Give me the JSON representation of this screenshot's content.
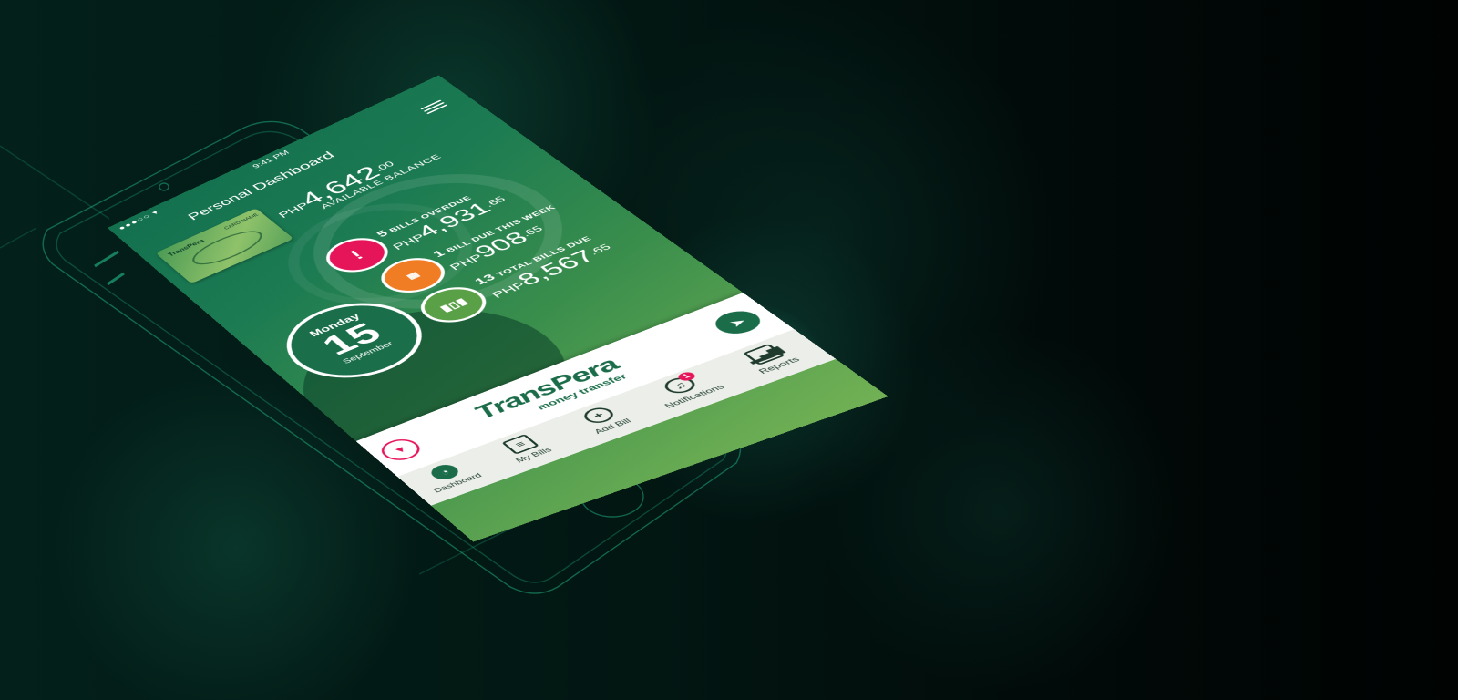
{
  "status_bar": {
    "signal": "●●●○○ ▾",
    "time": "9:41 PM"
  },
  "header": {
    "title": "Personal Dashboard"
  },
  "card": {
    "brand": "TransPera",
    "label": "CARD NAME"
  },
  "balance": {
    "currency": "PHP",
    "whole": "4,642",
    "cents": ".00",
    "label": "AVAILABLE BALANCE"
  },
  "date": {
    "day": "Monday",
    "number": "15",
    "month": "September"
  },
  "stats": [
    {
      "count": "5",
      "label": "BILLS OVERDUE",
      "currency": "PHP",
      "whole": "4,931",
      "cents": ".65",
      "icon": "exclamation-icon",
      "color": "#e6155a"
    },
    {
      "count": "1",
      "label": "BILL DUE THIS WEEK",
      "currency": "PHP",
      "whole": "908",
      "cents": ".65",
      "icon": "calendar-icon",
      "color": "#f07d23"
    },
    {
      "count": "13",
      "label": "TOTAL BILLS DUE",
      "currency": "PHP",
      "whole": "8,567",
      "cents": ".65",
      "icon": "barcode-icon",
      "color": "#5aa046"
    }
  ],
  "banner": {
    "logo": "TransPera",
    "tagline": "money transfer"
  },
  "tabs": [
    {
      "label": "Dashboard",
      "icon": "dashboard-icon"
    },
    {
      "label": "My Bills",
      "icon": "bills-icon"
    },
    {
      "label": "Add Bill",
      "icon": "plus-icon"
    },
    {
      "label": "Notifications",
      "icon": "bell-icon",
      "badge": "1"
    },
    {
      "label": "Reports",
      "icon": "reports-icon"
    }
  ],
  "colors": {
    "accent": "#1b6d4a",
    "overdue": "#e6155a",
    "due_week": "#f07d23",
    "total": "#5aa046"
  }
}
